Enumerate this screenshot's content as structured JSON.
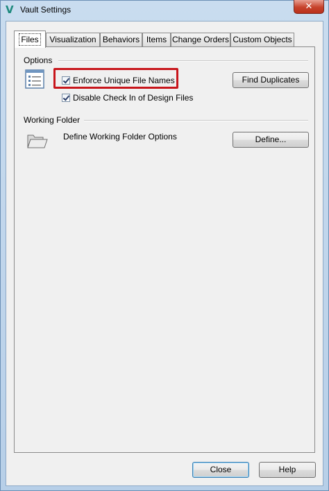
{
  "window": {
    "title": "Vault Settings",
    "app_icon": "vault-v-icon",
    "close_glyph": "✕"
  },
  "tabs": [
    {
      "label": "Files",
      "active": true
    },
    {
      "label": "Visualization",
      "active": false
    },
    {
      "label": "Behaviors",
      "active": false
    },
    {
      "label": "Items",
      "active": false
    },
    {
      "label": "Change Orders",
      "active": false
    },
    {
      "label": "Custom Objects",
      "active": false
    }
  ],
  "options": {
    "group_label": "Options",
    "icon": "list-settings-icon",
    "enforce_unique": {
      "label": "Enforce Unique File Names",
      "checked": true
    },
    "disable_checkin": {
      "label": "Disable Check In of Design Files",
      "checked": true
    },
    "find_duplicates_label": "Find Duplicates"
  },
  "working_folder": {
    "group_label": "Working Folder",
    "icon": "folder-open-icon",
    "description": "Define Working Folder Options",
    "define_label": "Define..."
  },
  "footer": {
    "close_label": "Close",
    "help_label": "Help"
  },
  "colors": {
    "highlight": "#c8151b",
    "close_button": "#c7432c"
  }
}
